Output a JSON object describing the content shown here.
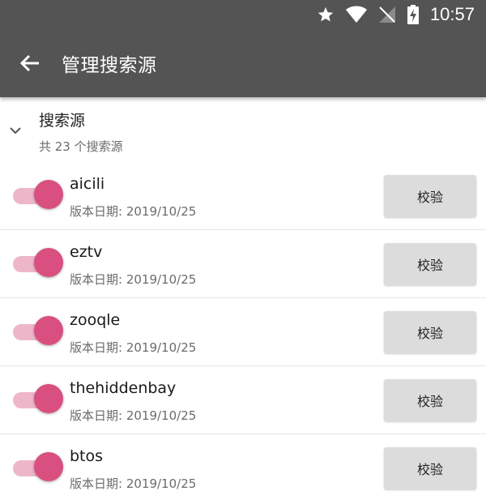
{
  "status_bar": {
    "time": "10:57",
    "icons": [
      "star-icon",
      "wifi-icon",
      "no-signal-icon",
      "battery-charging-icon"
    ]
  },
  "app_bar": {
    "back_icon": "arrow-left-icon",
    "title": "管理搜索源"
  },
  "group": {
    "title": "搜索源",
    "subtitle": "共 23 个搜索源",
    "expand_icon": "chevron-down-icon"
  },
  "sources": [
    {
      "name": "aicili",
      "date": "版本日期: 2019/10/25",
      "enabled": true,
      "verify_label": "校验"
    },
    {
      "name": "eztv",
      "date": "版本日期: 2019/10/25",
      "enabled": true,
      "verify_label": "校验"
    },
    {
      "name": "zooqle",
      "date": "版本日期: 2019/10/25",
      "enabled": true,
      "verify_label": "校验"
    },
    {
      "name": "thehiddenbay",
      "date": "版本日期: 2019/10/25",
      "enabled": true,
      "verify_label": "校验"
    },
    {
      "name": "btos",
      "date": "版本日期: 2019/10/25",
      "enabled": true,
      "verify_label": "校验"
    }
  ],
  "colors": {
    "app_bar": "#545454",
    "switch_thumb": "#d94f7f",
    "switch_track": "#eeb7c9",
    "button_bg": "#dcdcdc"
  }
}
